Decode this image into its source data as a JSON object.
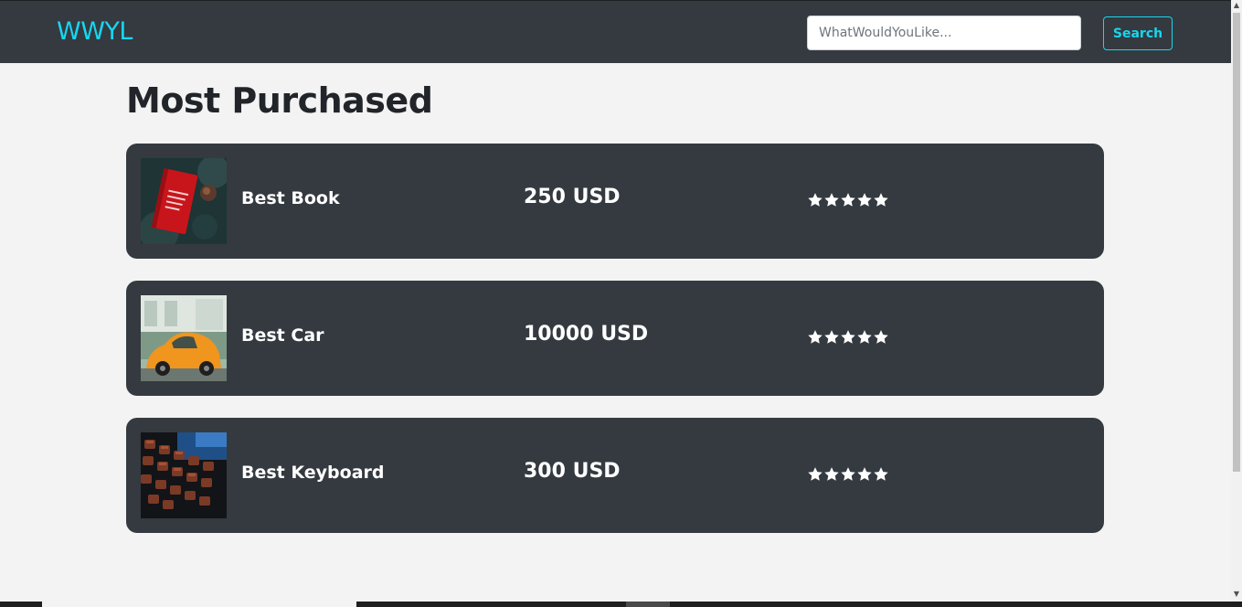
{
  "navbar": {
    "brand": "WWYL",
    "search_placeholder": "WhatWouldYouLike...",
    "search_value": "",
    "search_button": "Search",
    "accent": "#17d6f0",
    "background": "#343a40"
  },
  "page": {
    "title": "Most Purchased"
  },
  "products": [
    {
      "name": "Best Book",
      "price": "250 USD",
      "rating": 5,
      "image": "book-photo"
    },
    {
      "name": "Best Car",
      "price": "10000 USD",
      "rating": 5,
      "image": "car-photo"
    },
    {
      "name": "Best Keyboard",
      "price": "300 USD",
      "rating": 5,
      "image": "keyboard-photo"
    }
  ],
  "icons": {
    "star": "star-icon",
    "scroll_up": "scroll-up-arrow-icon",
    "scroll_down": "scroll-down-arrow-icon"
  }
}
